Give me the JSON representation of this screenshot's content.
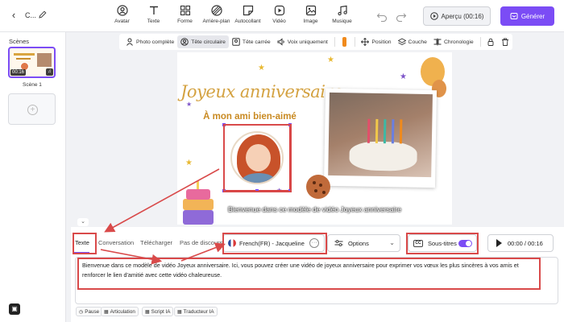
{
  "header": {
    "project_name": "C...",
    "tools": [
      {
        "label": "Avatar",
        "icon": "avatar-icon"
      },
      {
        "label": "Texte",
        "icon": "text-icon"
      },
      {
        "label": "Forme",
        "icon": "shape-icon"
      },
      {
        "label": "Arrière-plan",
        "icon": "background-icon"
      },
      {
        "label": "Autocollant",
        "icon": "sticker-icon"
      },
      {
        "label": "Vidéo",
        "icon": "video-icon"
      },
      {
        "label": "Image",
        "icon": "image-icon"
      },
      {
        "label": "Musique",
        "icon": "music-icon"
      }
    ],
    "preview_label": "Aperçu (00:16)",
    "generate_label": "Générer"
  },
  "scenes": {
    "title": "Scènes",
    "items": [
      {
        "label": "Scène 1",
        "duration": "00:16"
      }
    ]
  },
  "subtoolbar": {
    "items": [
      {
        "label": "Photo complète",
        "icon": "person-icon",
        "active": false
      },
      {
        "label": "Tête circulaire",
        "icon": "circle-head-icon",
        "active": true
      },
      {
        "label": "Tête carrée",
        "icon": "square-head-icon",
        "active": false
      },
      {
        "label": "Voix uniquement",
        "icon": "voice-icon",
        "active": false
      }
    ],
    "color": "#f08a1c",
    "right_items": [
      {
        "label": "Position",
        "icon": "move-icon"
      },
      {
        "label": "Couche",
        "icon": "layers-icon"
      },
      {
        "label": "Chronologie",
        "icon": "timeline-icon"
      }
    ]
  },
  "canvas": {
    "title": "Joyeux anniversaire",
    "subtitle": "À mon ami bien-aimé",
    "caption": "Bienvenue dans ce modèle de vidéo Joyeux anniversaire"
  },
  "bottom_panel": {
    "tabs": [
      "Texte",
      "Conversation",
      "Télécharger",
      "Pas de discours"
    ],
    "active_tab": "Texte",
    "voice": "French(FR) - Jacqueline",
    "options_label": "Options",
    "subtitles_label": "Sous-titres",
    "subtitles_on": true,
    "time": "00:00 / 00:16",
    "script": "Bienvenue dans ce modèle de vidéo Joyeux anniversaire. Ici, vous pouvez créer une vidéo de joyeux anniversaire pour exprimer vos vœux les plus sincères à vos amis et renforcer le lien d'amitié avec cette vidéo chaleureuse.",
    "chips": [
      {
        "label": "Pause",
        "icon": "clock-icon"
      },
      {
        "label": "Articulation",
        "icon": "articulation-icon"
      },
      {
        "label": "Script IA",
        "icon": "ai-script-icon"
      },
      {
        "label": "Traducteur IA",
        "icon": "translate-icon"
      }
    ]
  },
  "colors": {
    "accent": "#7b4cf5",
    "annotation": "#d94a4a",
    "title_gold": "#d4a241"
  }
}
